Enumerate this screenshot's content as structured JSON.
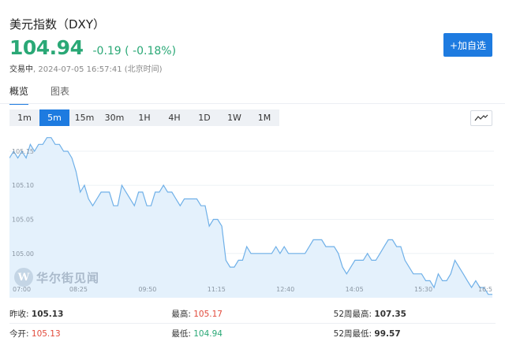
{
  "header": {
    "title": "美元指数（DXY）",
    "price": "104.94",
    "change": "-0.19 ( -0.18%)",
    "status": "交易中",
    "timestamp": ", 2024-07-05 16:57:41 (北京时间)",
    "watch_label": "+加自选"
  },
  "tabs": [
    {
      "label": "概览",
      "active": true
    },
    {
      "label": "图表",
      "active": false
    }
  ],
  "intervals": [
    "1m",
    "5m",
    "15m",
    "30m",
    "1H",
    "4H",
    "1D",
    "1W",
    "1M"
  ],
  "active_interval": "5m",
  "watermark": "华尔街见闻",
  "colors": {
    "accent": "#1e7be0",
    "down": "#2aa876",
    "up": "#e24a3b",
    "line": "#6fb0e8",
    "fill": "#e4f1fc"
  },
  "stats": {
    "prev_close_label": "昨收:",
    "prev_close": "105.13",
    "high_label": "最高:",
    "high": "105.17",
    "high52_label": "52周最高:",
    "high52": "107.35",
    "open_label": "今开:",
    "open": "105.13",
    "low_label": "最低:",
    "low": "104.94",
    "low52_label": "52周最低:",
    "low52": "99.57"
  },
  "chart_data": {
    "type": "area",
    "x_ticks": [
      "07:00",
      "08:25",
      "09:50",
      "11:15",
      "12:40",
      "14:05",
      "15:30",
      "16:5"
    ],
    "y_ticks": [
      "105.15",
      "105.10",
      "105.05",
      "105.00"
    ],
    "ylim": [
      104.935,
      105.18
    ],
    "values": [
      105.14,
      105.15,
      105.14,
      105.15,
      105.14,
      105.16,
      105.15,
      105.16,
      105.16,
      105.17,
      105.17,
      105.16,
      105.16,
      105.15,
      105.15,
      105.14,
      105.12,
      105.09,
      105.1,
      105.08,
      105.07,
      105.08,
      105.09,
      105.09,
      105.09,
      105.07,
      105.07,
      105.1,
      105.09,
      105.08,
      105.07,
      105.09,
      105.09,
      105.07,
      105.07,
      105.09,
      105.09,
      105.1,
      105.09,
      105.09,
      105.08,
      105.07,
      105.08,
      105.08,
      105.08,
      105.08,
      105.07,
      105.07,
      105.04,
      105.05,
      105.05,
      105.04,
      104.99,
      104.98,
      104.98,
      104.99,
      104.99,
      105.01,
      105.0,
      105.0,
      105.0,
      105.0,
      105.0,
      105.0,
      105.01,
      105.0,
      105.01,
      105.0,
      105.0,
      105.0,
      105.0,
      105.0,
      105.01,
      105.02,
      105.02,
      105.02,
      105.01,
      105.01,
      105.01,
      105.0,
      104.98,
      104.97,
      104.98,
      104.99,
      104.99,
      104.99,
      105.0,
      104.99,
      104.99,
      105.0,
      105.01,
      105.02,
      105.02,
      105.01,
      105.01,
      104.99,
      104.98,
      104.97,
      104.97,
      104.97,
      104.96,
      104.96,
      104.95,
      104.97,
      104.96,
      104.96,
      104.97,
      104.99,
      104.98,
      104.97,
      104.96,
      104.95,
      104.96,
      104.95,
      104.95,
      104.94,
      104.94
    ]
  }
}
